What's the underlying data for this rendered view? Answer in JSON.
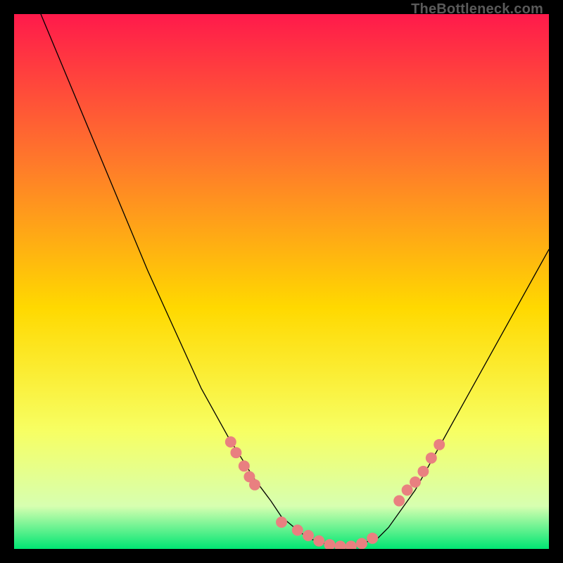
{
  "watermark": "TheBottleneck.com",
  "chart_data": {
    "type": "line",
    "title": "",
    "xlabel": "",
    "ylabel": "",
    "xlim": [
      0,
      100
    ],
    "ylim": [
      0,
      100
    ],
    "grid": false,
    "legend": false,
    "background_gradient": {
      "top": "#ff1a4b",
      "upper_mid": "#ff7a2a",
      "mid": "#ffd900",
      "lower_mid": "#f7ff63",
      "near_bottom": "#d7ffb0",
      "bottom": "#00e673"
    },
    "series": [
      {
        "name": "bottleneck-curve",
        "color": "#000000",
        "x": [
          5,
          10,
          15,
          20,
          25,
          30,
          35,
          40,
          45,
          48,
          50,
          53,
          55,
          58,
          60,
          63,
          65,
          68,
          70,
          75,
          80,
          85,
          90,
          95,
          100
        ],
        "y": [
          100,
          88,
          76,
          64,
          52,
          41,
          30,
          21,
          13,
          9,
          6,
          3.5,
          2,
          1,
          0.5,
          0.5,
          1,
          2,
          4,
          11,
          20,
          29,
          38,
          47,
          56
        ]
      }
    ],
    "markers": {
      "name": "salmon-dots",
      "color": "#e98080",
      "x": [
        40.5,
        41.5,
        43,
        44,
        45,
        50,
        53,
        55,
        57,
        59,
        61,
        63,
        65,
        67,
        72,
        73.5,
        75,
        76.5,
        78,
        79.5
      ],
      "y": [
        20,
        18,
        15.5,
        13.5,
        12,
        5,
        3.5,
        2.5,
        1.5,
        0.8,
        0.5,
        0.5,
        1,
        2,
        9,
        11,
        12.5,
        14.5,
        17,
        19.5
      ]
    }
  }
}
